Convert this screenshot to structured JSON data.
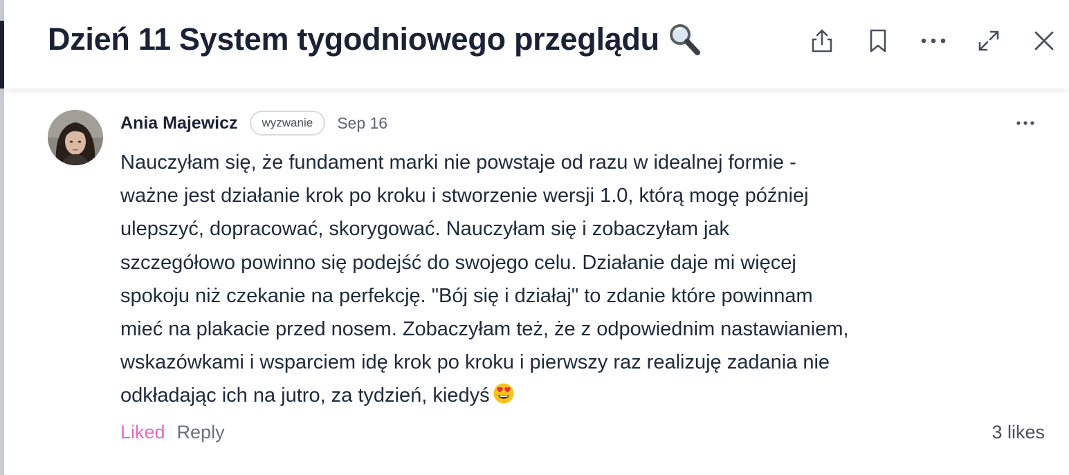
{
  "header": {
    "title": "Dzień 11 System tygodniowego przeglądu",
    "title_emoji": "magnifying-glass-icon",
    "actions": {
      "share": "share-icon",
      "bookmark": "bookmark-icon",
      "more": "more-horizontal-icon",
      "expand": "expand-icon",
      "close": "close-icon"
    }
  },
  "comment": {
    "author": "Ania Majewicz",
    "badge": "wyzwanie",
    "date": "Sep 16",
    "text": "Nauczyłam się, że fundament marki nie powstaje od razu w idealnej formie -\nważne jest działanie krok po kroku i stworzenie wersji 1.0, którą mogę później\nulepszyć, dopracować, skorygować. Nauczyłam się i zobaczyłam jak\nszczegółowo powinno się podejść do swojego celu. Działanie daje mi więcej\nspokoju niż czekanie na perfekcję.  \"Bój się i działaj\" to zdanie które powinnam\nmieć na plakacie przed nosem. Zobaczyłam też, że z odpowiednim nastawianiem,\nwskazówkami i wsparciem idę krok po kroku i pierwszy raz realizuję zadania nie\nodkładając ich na jutro, za tydzień, kiedyś",
    "text_emoji": "heart-eyes-emoji-icon",
    "liked_label": "Liked",
    "reply_label": "Reply",
    "likes_count": "3 likes"
  },
  "colors": {
    "liked": "#e26ac3",
    "title": "#1b2236",
    "muted": "#6b7079"
  }
}
